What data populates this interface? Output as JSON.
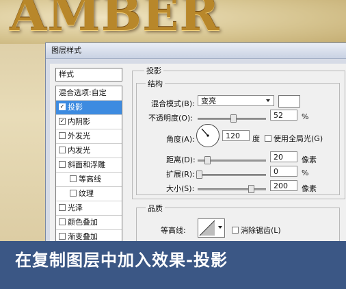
{
  "banner": {
    "text": "AMBER"
  },
  "dialog": {
    "title": "图层样式"
  },
  "sidebar": {
    "header": "样式",
    "items": [
      {
        "label": "混合选项:自定",
        "checkbox": false,
        "checked": false,
        "selected": false,
        "sub": false
      },
      {
        "label": "投影",
        "checkbox": true,
        "checked": true,
        "selected": true,
        "sub": false
      },
      {
        "label": "内阴影",
        "checkbox": true,
        "checked": true,
        "selected": false,
        "sub": false
      },
      {
        "label": "外发光",
        "checkbox": true,
        "checked": false,
        "selected": false,
        "sub": false
      },
      {
        "label": "内发光",
        "checkbox": true,
        "checked": false,
        "selected": false,
        "sub": false
      },
      {
        "label": "斜面和浮雕",
        "checkbox": true,
        "checked": false,
        "selected": false,
        "sub": false
      },
      {
        "label": "等高线",
        "checkbox": true,
        "checked": false,
        "selected": false,
        "sub": true
      },
      {
        "label": "纹理",
        "checkbox": true,
        "checked": false,
        "selected": false,
        "sub": true
      },
      {
        "label": "光泽",
        "checkbox": true,
        "checked": false,
        "selected": false,
        "sub": false
      },
      {
        "label": "颜色叠加",
        "checkbox": true,
        "checked": false,
        "selected": false,
        "sub": false
      },
      {
        "label": "渐变叠加",
        "checkbox": true,
        "checked": false,
        "selected": false,
        "sub": false
      }
    ]
  },
  "panel": {
    "title": "投影",
    "structure": {
      "title": "结构",
      "blend_label": "混合模式(B):",
      "blend_value": "变亮",
      "opacity_label": "不透明度(O):",
      "opacity_value": "52",
      "opacity_unit": "%",
      "opacity_level": 0.52,
      "angle_label": "角度(A):",
      "angle_value": "120",
      "angle_unit": "度",
      "global_light_label": "使用全局光(G)",
      "distance_label": "距离(D):",
      "distance_value": "20",
      "distance_unit": "像素",
      "spread_label": "扩展(R):",
      "spread_value": "0",
      "spread_unit": "%",
      "size_label": "大小(S):",
      "size_value": "200",
      "size_unit": "像素"
    },
    "quality": {
      "title": "品质",
      "contour_label": "等高线:",
      "antialias_label": "消除锯齿(L)"
    }
  },
  "footer": {
    "caption": "在复制图层中加入效果-投影"
  },
  "colors": {
    "footer_bg": "#3b5785",
    "selection": "#3d8be0",
    "banner_gold": "#b8872a"
  }
}
